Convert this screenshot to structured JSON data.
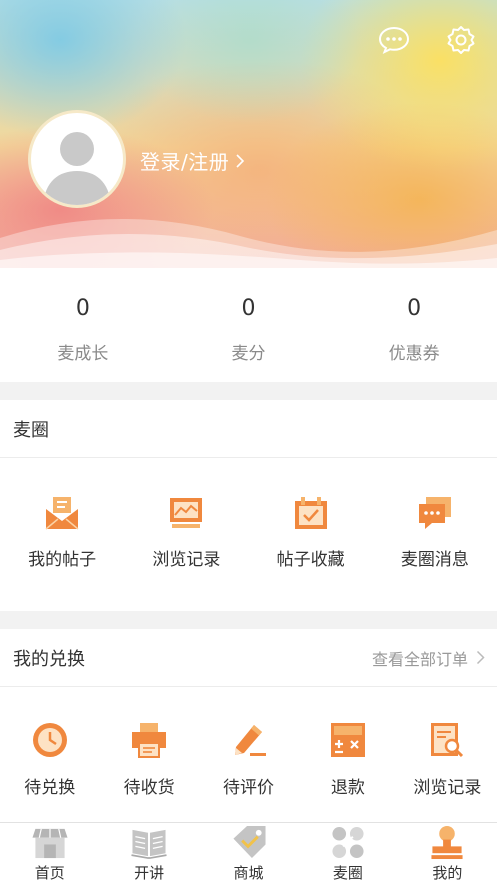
{
  "header": {
    "login_label": "登录/注册"
  },
  "stats": [
    {
      "value": "0",
      "label": "麦成长"
    },
    {
      "value": "0",
      "label": "麦分"
    },
    {
      "value": "0",
      "label": "优惠券"
    }
  ],
  "maiquan": {
    "title": "麦圈",
    "items": [
      {
        "label": "我的帖子",
        "icon": "post-envelope-icon"
      },
      {
        "label": "浏览记录",
        "icon": "chart-board-icon"
      },
      {
        "label": "帖子收藏",
        "icon": "bookmark-calendar-icon"
      },
      {
        "label": "麦圈消息",
        "icon": "message-stack-icon"
      }
    ]
  },
  "exchange": {
    "title": "我的兑换",
    "view_all": "查看全部订单",
    "items": [
      {
        "label": "待兑换",
        "icon": "clock-icon"
      },
      {
        "label": "待收货",
        "icon": "printer-icon"
      },
      {
        "label": "待评价",
        "icon": "pencil-icon"
      },
      {
        "label": "退款",
        "icon": "calculator-icon"
      },
      {
        "label": "浏览记录",
        "icon": "document-search-icon"
      }
    ]
  },
  "tabbar": [
    {
      "label": "首页",
      "active": false
    },
    {
      "label": "开讲",
      "active": false
    },
    {
      "label": "商城",
      "active": false
    },
    {
      "label": "麦圈",
      "active": false
    },
    {
      "label": "我的",
      "active": true
    }
  ],
  "colors": {
    "accent": "#f0883e",
    "accent_light": "#f6b36b",
    "nav_gray": "#a9a9a9"
  }
}
